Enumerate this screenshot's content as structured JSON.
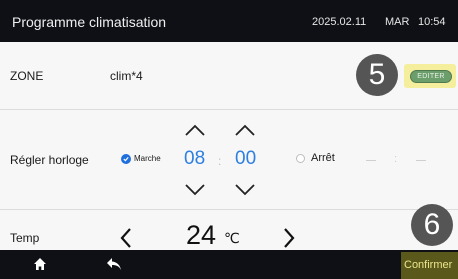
{
  "header": {
    "title": "Programme climatisation",
    "date": "2025.02.11",
    "day": "MAR",
    "time": "10:54"
  },
  "zone": {
    "label": "ZONE",
    "value": "clim*4",
    "marker": "5",
    "edit_label": "EDITER"
  },
  "clock": {
    "label": "Régler horloge",
    "on_label": "Marche",
    "hours": "08",
    "separator": ":",
    "minutes": "00",
    "off_label": "Arrêt",
    "on_selected": true
  },
  "temp": {
    "label": "Temp",
    "value": "24",
    "unit": "℃",
    "marker": "6"
  },
  "footer": {
    "confirm_label": "Confirmer",
    "home_icon": "home-icon",
    "back_icon": "back-icon"
  },
  "colors": {
    "header_bg": "#0e1015",
    "accent_blue": "#2d7fe0",
    "edit_green": "#6c9e6c",
    "highlight_yellow": "#f5ee9c",
    "confirm_bg": "#5a581a"
  }
}
